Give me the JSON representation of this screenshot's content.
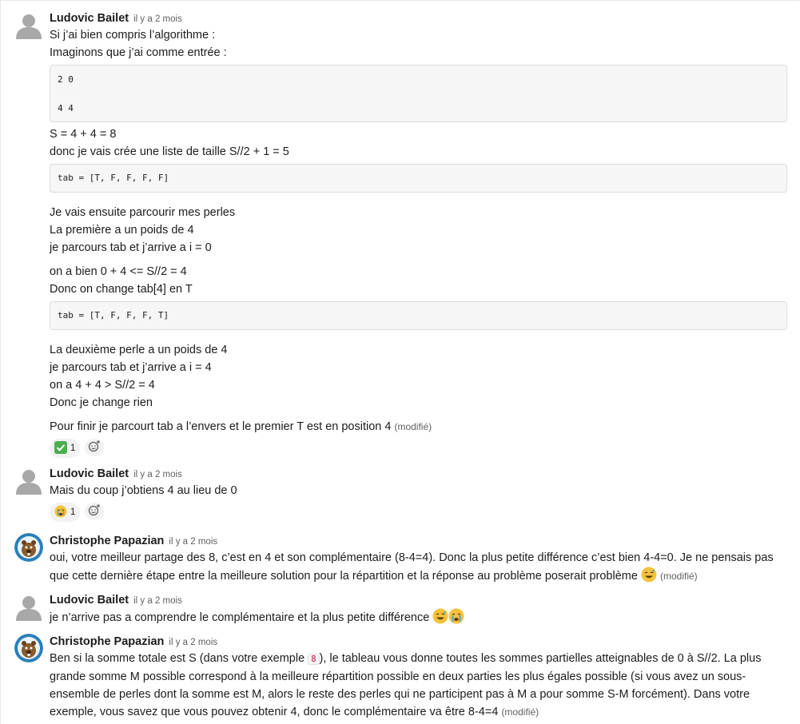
{
  "messages": [
    {
      "author": "Ludovic Bailet",
      "time": "il y a 2 mois",
      "lines": {
        "l1": "Si j’ai bien compris l’algorithme :",
        "l2": "Imaginons que j’ai comme entrée :",
        "code1a": "2 0",
        "code1b": "4 4",
        "l3": "S = 4 + 4 = 8",
        "l4": "donc je vais crée une liste de taille S//2 + 1 = 5",
        "code2": "tab = [T, F, F, F, F]",
        "l5": "Je vais ensuite parcourir mes perles",
        "l6": "La première a un poids de 4",
        "l7": "je parcours tab et j’arrive a i = 0",
        "l8": "on a bien 0 + 4 <= S//2 = 4",
        "l9": "Donc on change tab[4] en T",
        "code3": "tab = [T, F, F, F, T]",
        "l10": "La deuxième perle a un poids de 4",
        "l11": "je parcours tab et j’arrive a i = 4",
        "l12": "on a 4 + 4 > S//2 = 4",
        "l13": "Donc je change rien",
        "l14": "Pour finir je parcourt tab a l’envers et le premier T est en position 4"
      },
      "edited": "(modifié)",
      "reaction": {
        "emoji": "check-mark-button",
        "count": "1"
      }
    },
    {
      "author": "Ludovic Bailet",
      "time": "il y a 2 mois",
      "text": "Mais du coup j’obtiens 4 au lieu de 0",
      "reaction": {
        "emoji": "crying-face",
        "count": "1"
      }
    },
    {
      "author": "Christophe Papazian",
      "time": "il y a 2 mois",
      "text1": "oui, votre meilleur partage des 8, c’est en 4 et son complémentaire (8-4=4). Donc la plus petite différence c’est bien 4-4=0. Je ne pensais pas",
      "text2": "que cette dernière étape entre la meilleure solution pour la répartition et la réponse au problème poserait problème",
      "edited": "(modifié)"
    },
    {
      "author": "Ludovic Bailet",
      "time": "il y a 2 mois",
      "text": "je n’arrive pas a comprendre le complémentaire et la plus petite différence"
    },
    {
      "author": "Christophe Papazian",
      "time": "il y a 2 mois",
      "t1a": "Ben si la somme totale est S (dans votre exemple",
      "code": "8",
      "t1b": "), le tableau vous donne toutes les sommes partielles atteignables de 0 à S//2. La plus",
      "t2": "grande somme M possible correspond à la meilleure répartition possible en deux parties les plus égales possible (si vous avez un sous-",
      "t3": "ensemble de perles dont la somme est M, alors le reste des perles qui ne participent pas à M a pour somme S-M forcément). Dans votre",
      "t4": "exemple, vous savez que vous pouvez obtenir 4, donc le complémentaire va être 8-4=4",
      "edited": "(modifié)"
    }
  ],
  "colors": {
    "text": "#1d1c1d",
    "muted": "#616061",
    "code_bg": "#f6f6f6",
    "inline_code": "#c01343"
  }
}
